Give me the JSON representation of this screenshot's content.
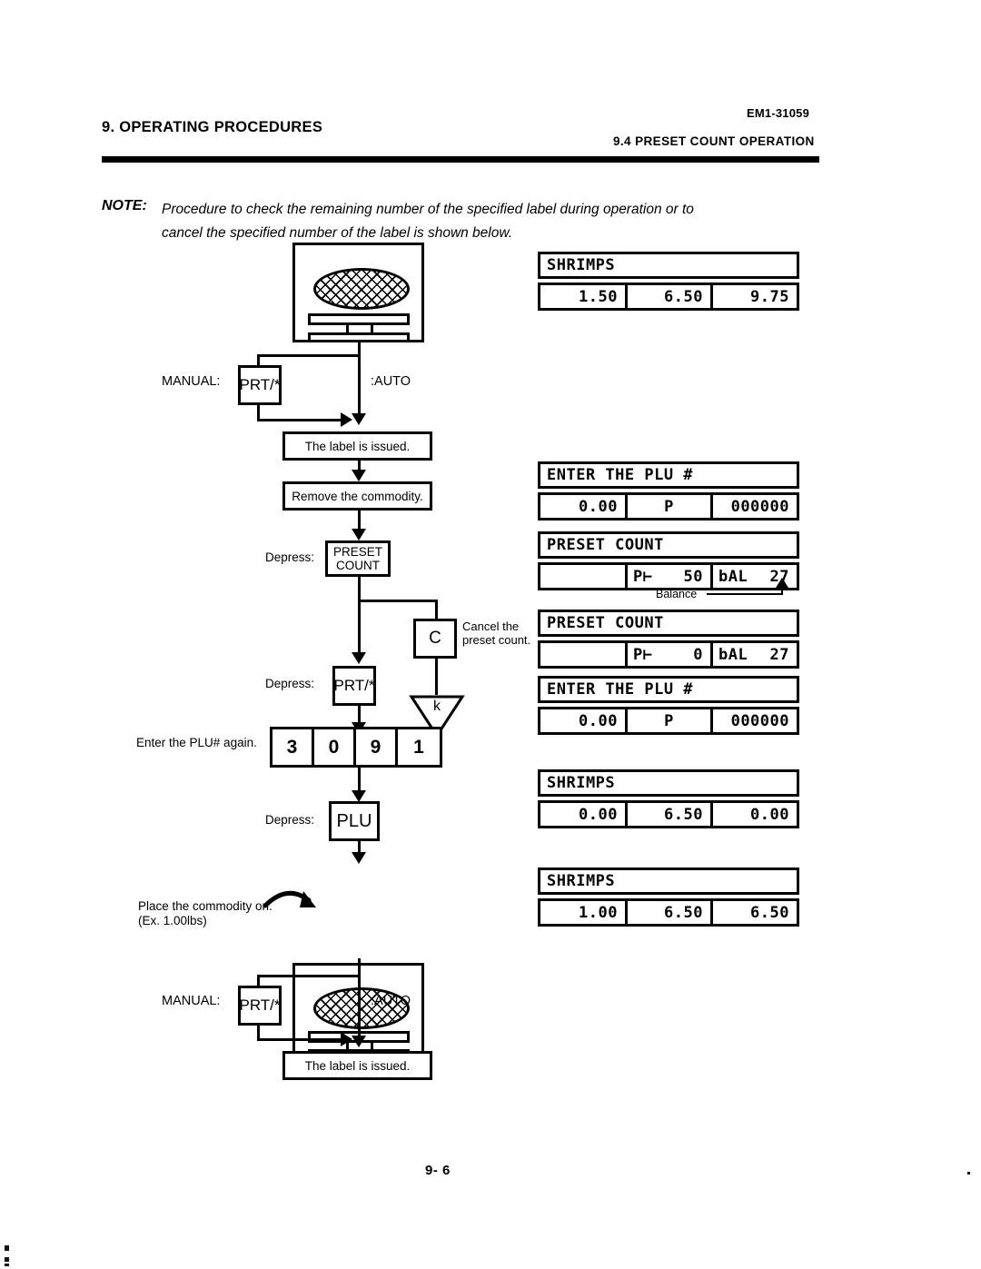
{
  "header": {
    "doc_code": "EM1-31059",
    "chapter_title": "9. OPERATING PROCEDURES",
    "section_title": "9.4  PRESET COUNT OPERATION"
  },
  "note": {
    "label": "NOTE:",
    "line1": "Procedure to check the remaining number of the specified label during operation or to",
    "line2": "cancel the specified number of the label is shown below."
  },
  "flow": {
    "manual_label": "MANUAL:",
    "auto_label": ":AUTO",
    "prt_key": "PRT/*",
    "label_issued_1": "The label is issued.",
    "remove_commodity": "Remove the commodity.",
    "depress_1": "Depress:",
    "preset_count_key_line1": "PRESET",
    "preset_count_key_line2": "COUNT",
    "cancel_key": "C",
    "cancel_note_line1": "Cancel the",
    "cancel_note_line2": "preset count.",
    "depress_2": "Depress:",
    "connector_label": "k",
    "enter_plu_again": "Enter the PLU# again.",
    "keypad_digits": [
      "3",
      "0",
      "9",
      "1"
    ],
    "depress_3": "Depress:",
    "plu_key": "PLU",
    "place_commodity_line1": "Place the commodity on.",
    "place_commodity_line2": "(Ex. 1.00lbs)",
    "manual_label_2": "MANUAL:",
    "auto_label_2": ":AUTO",
    "prt_key_2": "PRT/*",
    "label_issued_2": "The label is issued."
  },
  "displays": [
    {
      "name": "display-shrimps-initial",
      "title": "SHRIMPS",
      "cells": [
        {
          "text": "1.50",
          "align": "num"
        },
        {
          "text": "6.50",
          "align": "num"
        },
        {
          "text": "9.75",
          "align": "num"
        }
      ]
    },
    {
      "name": "display-enter-plu-1",
      "title": "ENTER THE PLU #",
      "cells": [
        {
          "text": "0.00",
          "align": "num"
        },
        {
          "text": "P",
          "align": "ctr"
        },
        {
          "text": "000000",
          "align": "num"
        }
      ]
    },
    {
      "name": "display-preset-count-50",
      "title": "PRESET COUNT",
      "cells": [
        {
          "text": "",
          "align": "num"
        },
        {
          "text": "P⊢",
          "text2": "50",
          "align": "split"
        },
        {
          "text": "bAL",
          "text2": "27",
          "align": "split"
        }
      ]
    },
    {
      "name": "display-preset-count-0",
      "title": "PRESET COUNT",
      "cells": [
        {
          "text": "",
          "align": "num"
        },
        {
          "text": "P⊢",
          "text2": "0",
          "align": "split"
        },
        {
          "text": "bAL",
          "text2": "27",
          "align": "split"
        }
      ]
    },
    {
      "name": "display-enter-plu-2",
      "title": "ENTER THE PLU #",
      "cells": [
        {
          "text": "0.00",
          "align": "num"
        },
        {
          "text": "P",
          "align": "ctr"
        },
        {
          "text": "000000",
          "align": "num"
        }
      ]
    },
    {
      "name": "display-shrimps-zero",
      "title": "SHRIMPS",
      "cells": [
        {
          "text": "0.00",
          "align": "num"
        },
        {
          "text": "6.50",
          "align": "num"
        },
        {
          "text": "0.00",
          "align": "num"
        }
      ]
    },
    {
      "name": "display-shrimps-final",
      "title": "SHRIMPS",
      "cells": [
        {
          "text": "1.00",
          "align": "num"
        },
        {
          "text": "6.50",
          "align": "num"
        },
        {
          "text": "6.50",
          "align": "num"
        }
      ]
    }
  ],
  "annotations": {
    "balance": "Balance"
  },
  "footer": {
    "page_number": "9- 6"
  }
}
